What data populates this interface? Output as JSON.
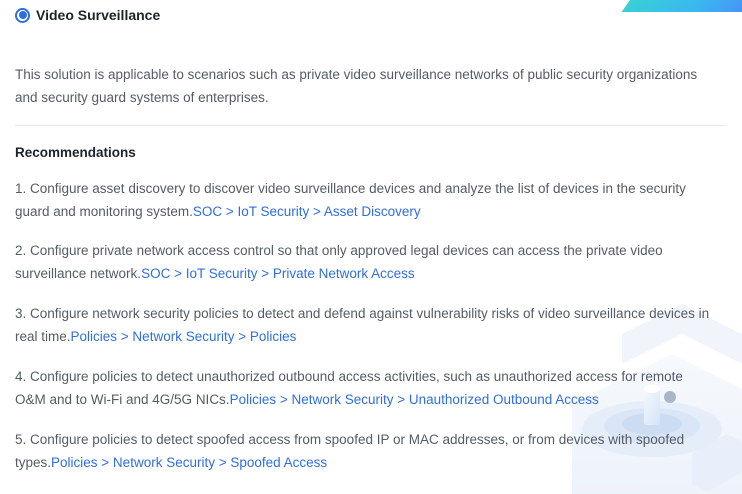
{
  "solution": {
    "title": "Video Surveillance",
    "selected": true,
    "description": "This solution is applicable to scenarios such as private video surveillance networks of public security organizations and security guard systems of enterprises."
  },
  "recommendations": {
    "heading": "Recommendations",
    "items": [
      {
        "text": "1. Configure asset discovery to discover video surveillance devices and analyze the list of devices in the security guard and monitoring system.",
        "link": "SOC > IoT Security > Asset Discovery"
      },
      {
        "text": "2. Configure private network access control so that only approved legal devices can access the private video surveillance network.",
        "link": "SOC > IoT Security > Private Network Access"
      },
      {
        "text": "3. Configure network security policies to detect and defend against vulnerability risks of video surveillance devices in real time.",
        "link": "Policies > Network Security > Policies"
      },
      {
        "text": "4. Configure policies to detect unauthorized outbound access activities, such as unauthorized access for remote O&M and to Wi-Fi and 4G/5G NICs.",
        "link": "Policies > Network Security > Unauthorized Outbound Access"
      },
      {
        "text": "5. Configure policies to detect spoofed access from spoofed IP or MAC addresses, or from devices with spoofed types.",
        "link": "Policies > Network Security > Spoofed Access"
      }
    ]
  },
  "colors": {
    "link": "#2f6ee0",
    "accent": "#3ab7f0",
    "text": "#555b66",
    "heading": "#1f2329"
  }
}
